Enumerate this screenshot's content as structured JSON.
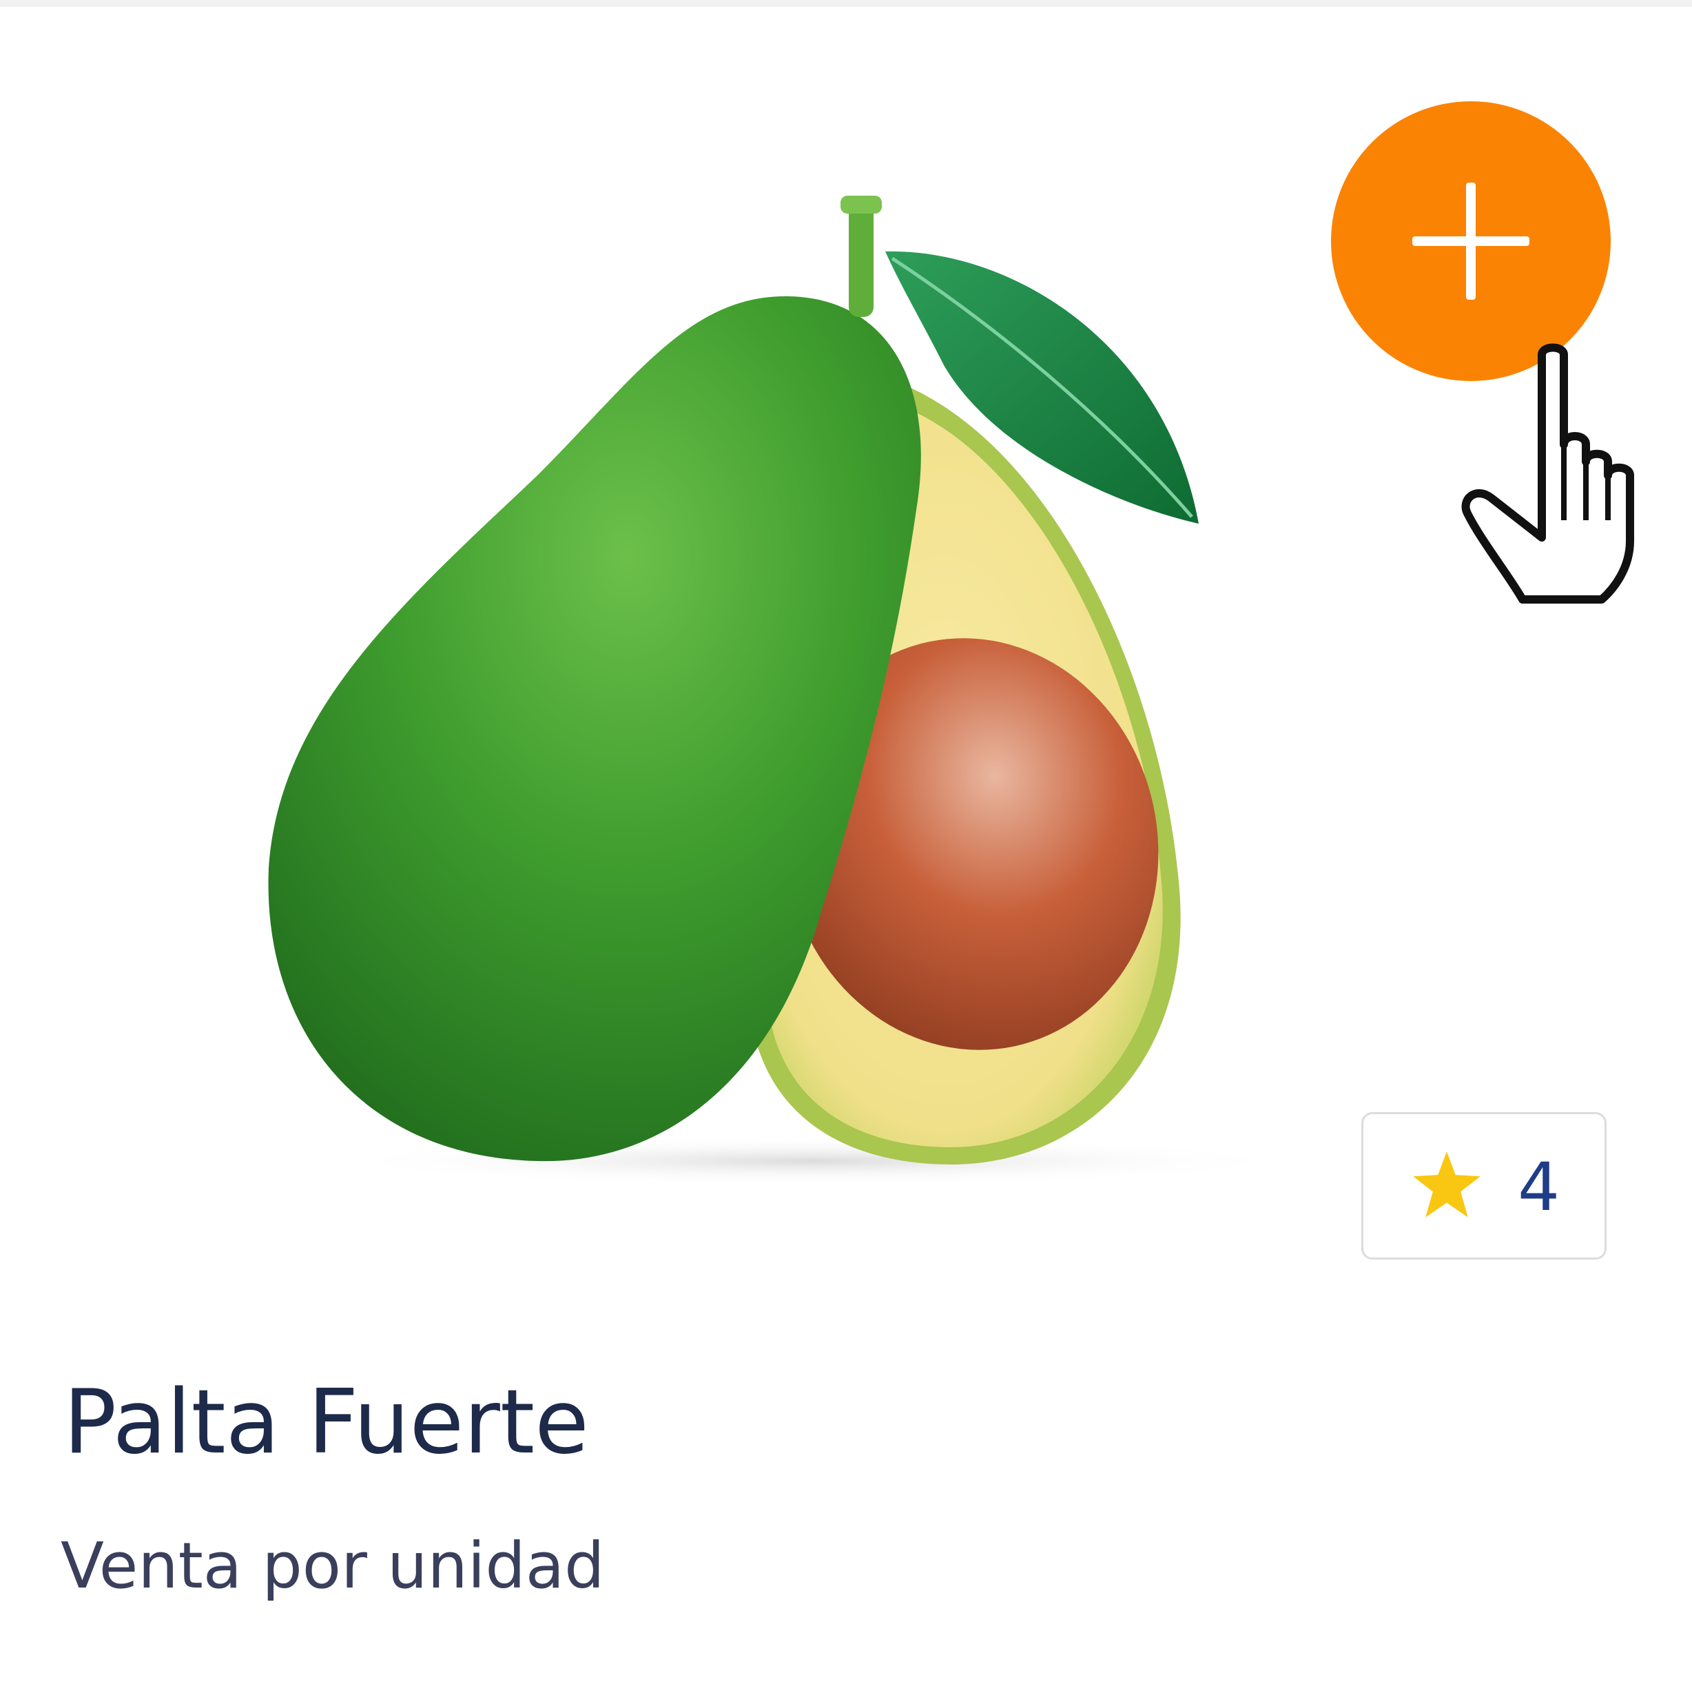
{
  "colors": {
    "accent": "#fb8303",
    "star": "#f9c611",
    "title_text": "#1e2a4a",
    "rating_text": "#1f3c88"
  },
  "product": {
    "name": "Palta Fuerte",
    "unit": "Venta por unidad",
    "rating": "4",
    "image_icon": "avocado-image"
  },
  "actions": {
    "add_icon": "plus-icon"
  }
}
